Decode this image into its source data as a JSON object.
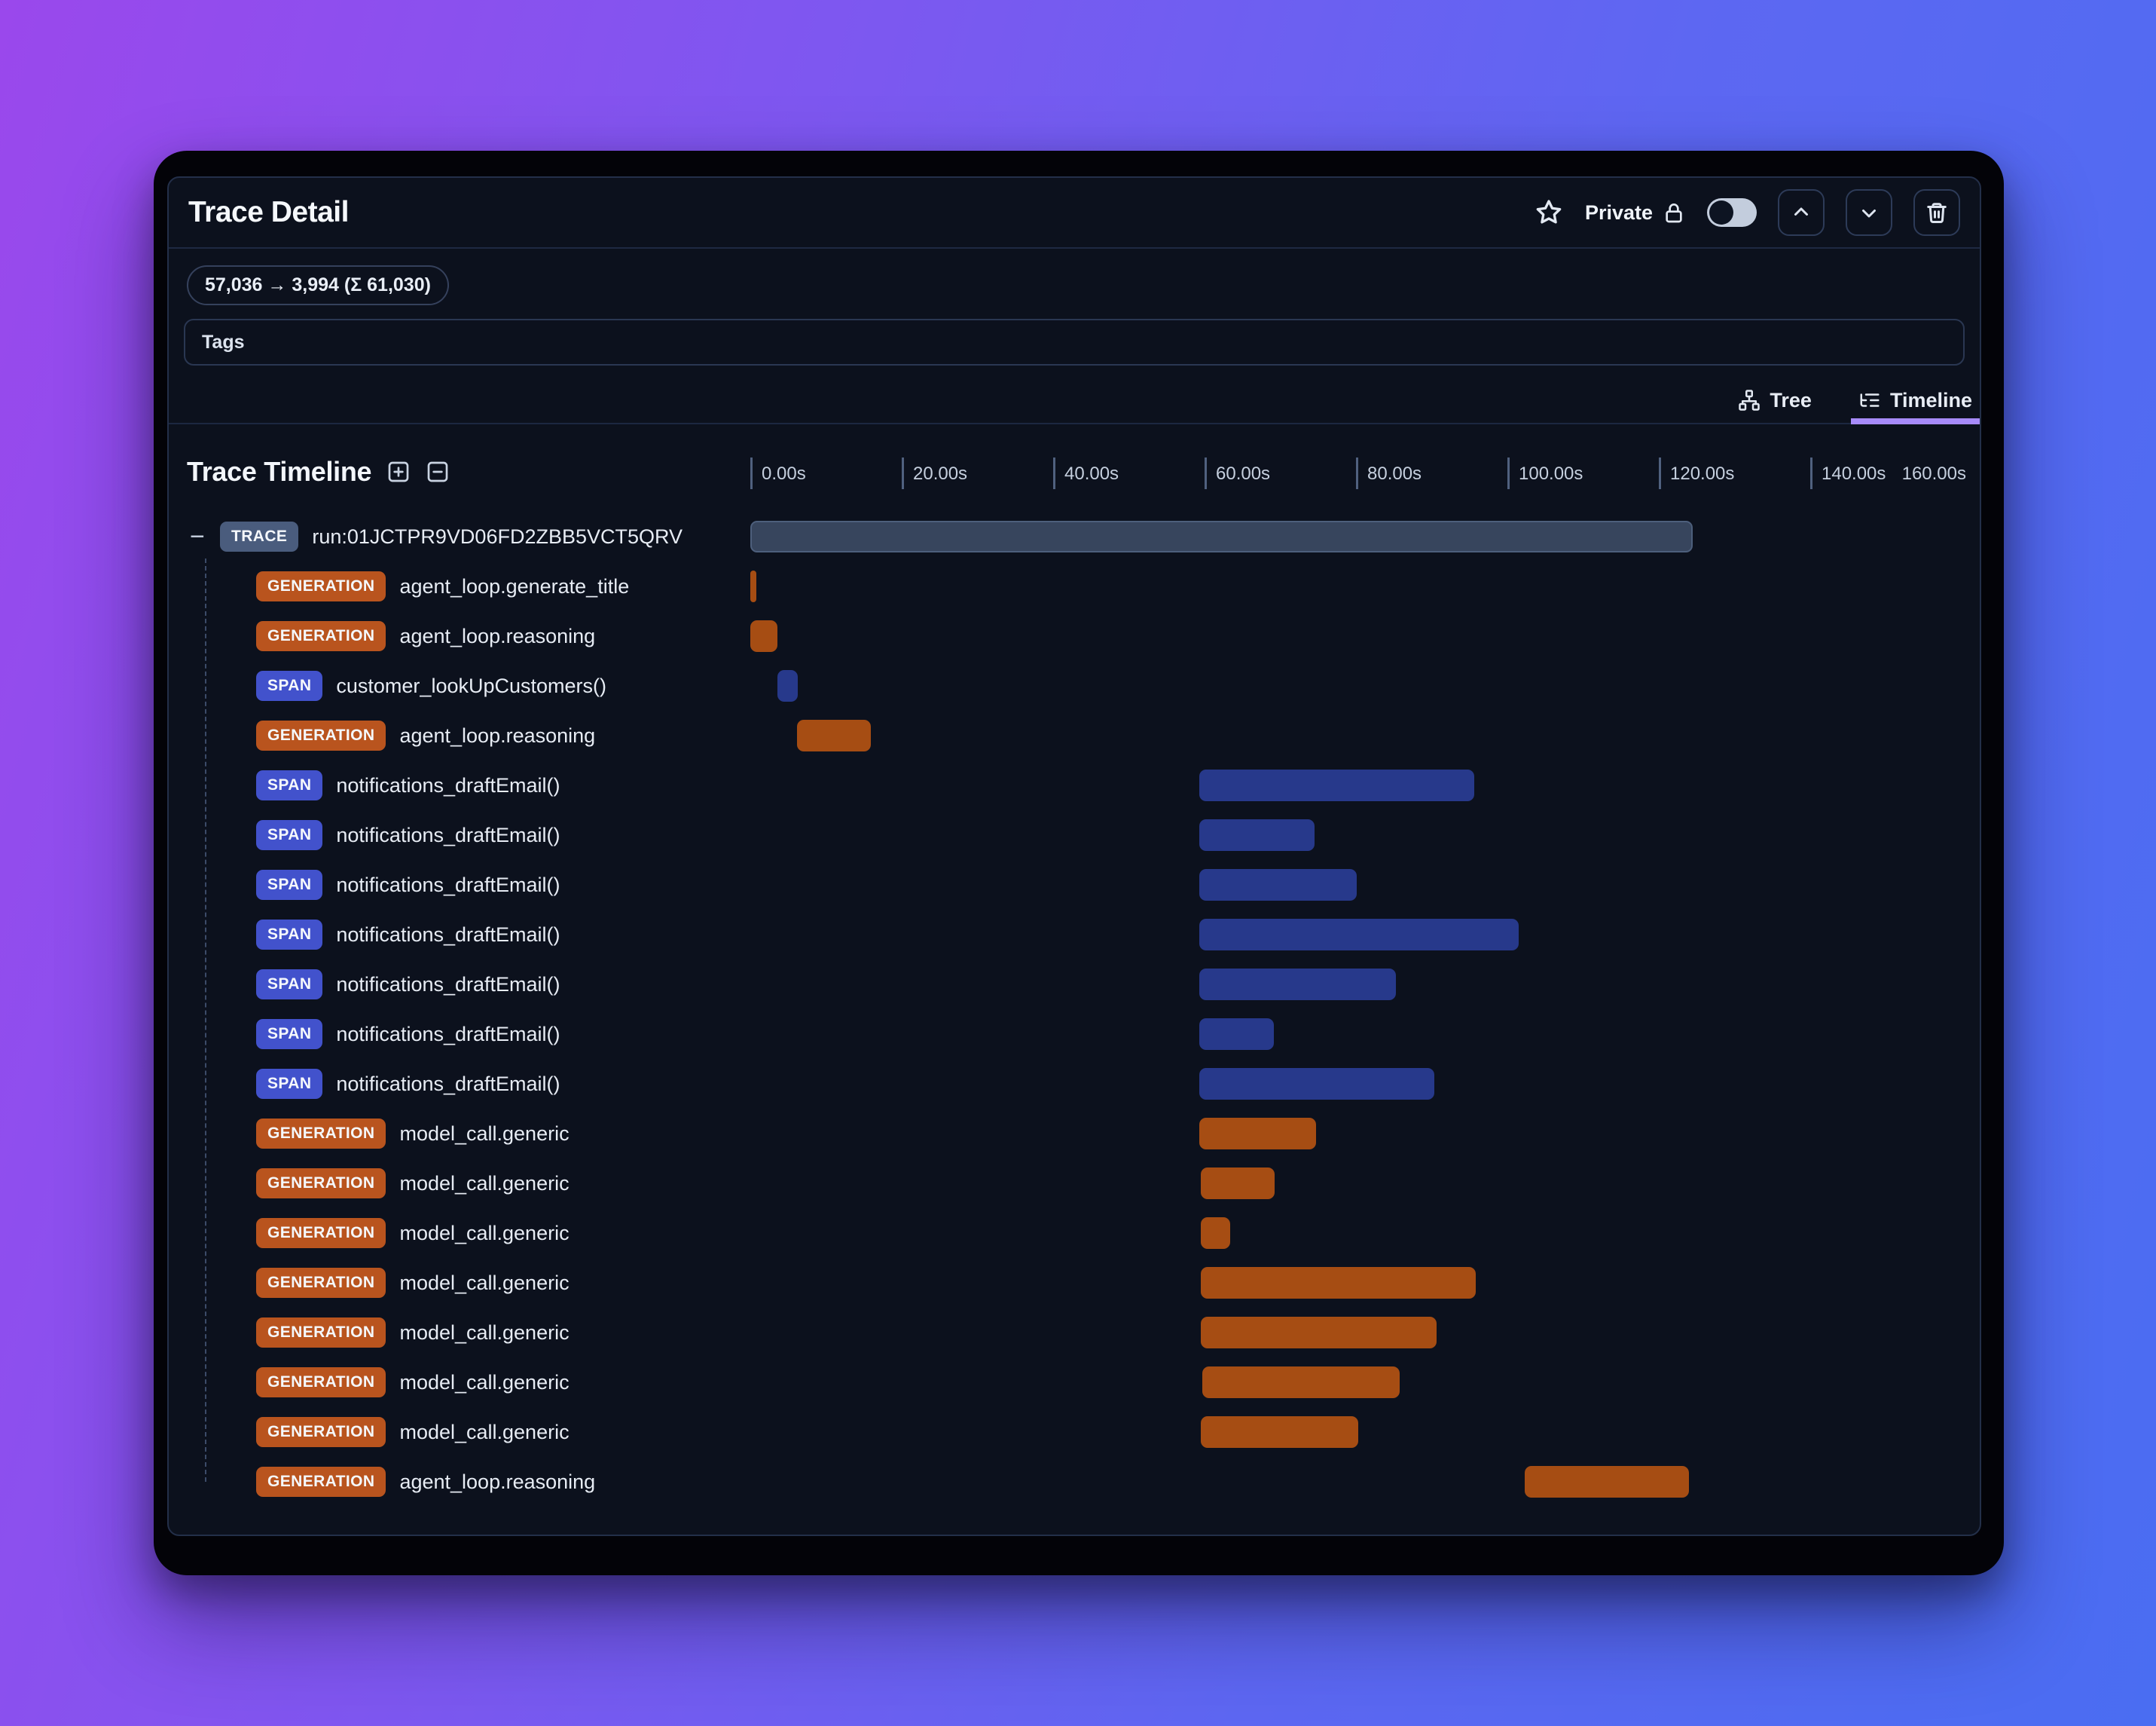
{
  "header": {
    "title": "Trace Detail",
    "favorite_icon": "star-icon",
    "privacy_label": "Private",
    "privacy_icon": "lock-icon",
    "public_toggle_on": false,
    "nav_buttons": [
      "chevron-up",
      "chevron-down",
      "trash"
    ]
  },
  "trace_stats": {
    "tokens": "57,036 → 3,994 (Σ 61,030)"
  },
  "tags": {
    "label": "Tags"
  },
  "view_tabs": [
    {
      "label": "Tree",
      "icon": "tree-icon",
      "active": false
    },
    {
      "label": "Timeline",
      "icon": "timeline-icon",
      "active": true
    }
  ],
  "timeline": {
    "title": "Trace Timeline",
    "expand_all_icon": "plus-square-icon",
    "collapse_all_icon": "minus-square-icon",
    "collapse_glyph": "−"
  },
  "colors": {
    "accent_tab_underline": "#a78bfa",
    "generation_badge": "#b9541e",
    "generation_bar": "#a64d13",
    "span_badge": "#4252cc",
    "span_bar": "#27398b",
    "trace_badge": "#4a5c7d",
    "trace_bar": "#37455d"
  },
  "chart_data": {
    "type": "timeline-gantt",
    "unit": "s",
    "xlim": [
      0,
      160
    ],
    "axis_ticks": [
      {
        "s": 0,
        "label": "0.00s"
      },
      {
        "s": 20,
        "label": "20.00s"
      },
      {
        "s": 40,
        "label": "40.00s"
      },
      {
        "s": 60,
        "label": "60.00s"
      },
      {
        "s": 80,
        "label": "80.00s"
      },
      {
        "s": 100,
        "label": "100.00s"
      },
      {
        "s": 120,
        "label": "120.00s"
      },
      {
        "s": 140,
        "label": "140.00s"
      },
      {
        "s": 160,
        "label": "160.00s",
        "mark": false
      }
    ],
    "rows": [
      {
        "type": "TRACE",
        "label": "run:01JCTPR9VD06FD2ZBB5VCT5QRV",
        "start_s": 0.0,
        "end_s": 124.5
      },
      {
        "type": "GENERATION",
        "label": "agent_loop.generate_title",
        "start_s": 0.0,
        "end_s": 0.8
      },
      {
        "type": "GENERATION",
        "label": "agent_loop.reasoning",
        "start_s": 0.0,
        "end_s": 3.6
      },
      {
        "type": "SPAN",
        "label": "customer_lookUpCustomers()",
        "start_s": 3.6,
        "end_s": 6.3
      },
      {
        "type": "GENERATION",
        "label": "agent_loop.reasoning",
        "start_s": 6.2,
        "end_s": 15.9
      },
      {
        "type": "SPAN",
        "label": "notifications_draftEmail()",
        "start_s": 59.3,
        "end_s": 95.6
      },
      {
        "type": "SPAN",
        "label": "notifications_draftEmail()",
        "start_s": 59.3,
        "end_s": 74.5
      },
      {
        "type": "SPAN",
        "label": "notifications_draftEmail()",
        "start_s": 59.3,
        "end_s": 80.1
      },
      {
        "type": "SPAN",
        "label": "notifications_draftEmail()",
        "start_s": 59.3,
        "end_s": 101.5
      },
      {
        "type": "SPAN",
        "label": "notifications_draftEmail()",
        "start_s": 59.3,
        "end_s": 85.3
      },
      {
        "type": "SPAN",
        "label": "notifications_draftEmail()",
        "start_s": 59.3,
        "end_s": 69.2
      },
      {
        "type": "SPAN",
        "label": "notifications_draftEmail()",
        "start_s": 59.3,
        "end_s": 90.3
      },
      {
        "type": "GENERATION",
        "label": "model_call.generic",
        "start_s": 59.3,
        "end_s": 74.7
      },
      {
        "type": "GENERATION",
        "label": "model_call.generic",
        "start_s": 59.5,
        "end_s": 69.3
      },
      {
        "type": "GENERATION",
        "label": "model_call.generic",
        "start_s": 59.5,
        "end_s": 63.4
      },
      {
        "type": "GENERATION",
        "label": "model_call.generic",
        "start_s": 59.5,
        "end_s": 95.8
      },
      {
        "type": "GENERATION",
        "label": "model_call.generic",
        "start_s": 59.5,
        "end_s": 90.6
      },
      {
        "type": "GENERATION",
        "label": "model_call.generic",
        "start_s": 59.7,
        "end_s": 85.8
      },
      {
        "type": "GENERATION",
        "label": "model_call.generic",
        "start_s": 59.5,
        "end_s": 80.3
      },
      {
        "type": "GENERATION",
        "label": "agent_loop.reasoning",
        "start_s": 102.3,
        "end_s": 124.0
      }
    ]
  }
}
